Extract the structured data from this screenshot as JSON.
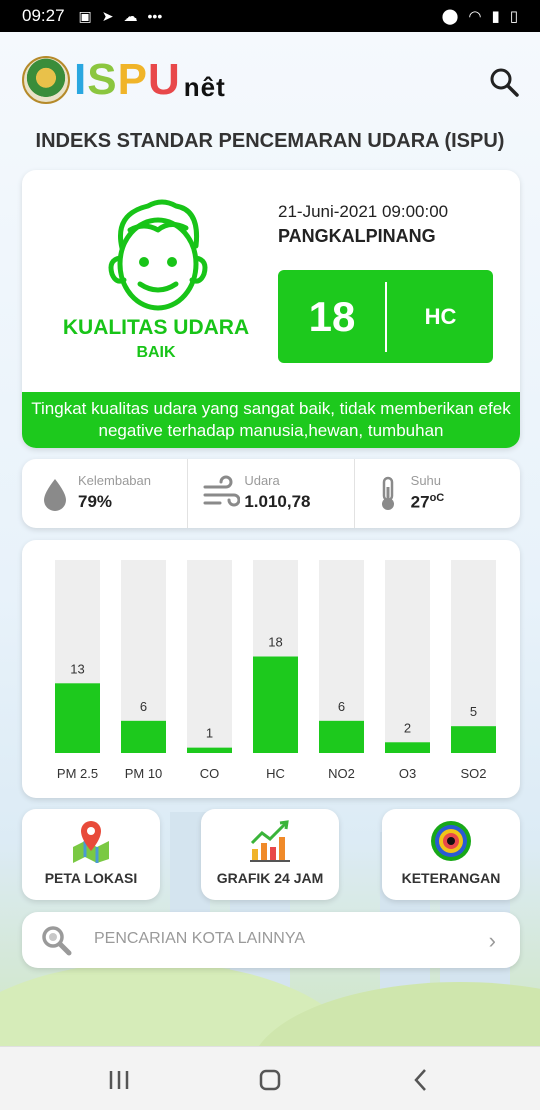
{
  "status_bar": {
    "time": "09:27",
    "icons": [
      "notification-icon",
      "telegram-icon",
      "weather-icon",
      "more-icon"
    ],
    "right_icons": [
      "location-icon",
      "wifi-icon",
      "signal-icon",
      "battery-icon"
    ]
  },
  "header": {
    "logo_letters": [
      "I",
      "S",
      "P",
      "U"
    ],
    "logo_suffix": "nêt"
  },
  "page_title": "INDEKS STANDAR PENCEMARAN UDARA (ISPU)",
  "summary": {
    "quality_label": "KUALITAS UDARA",
    "quality_status": "BAIK",
    "datetime": "21-Juni-2021 09:00:00",
    "city": "PANGKALPINANG",
    "value": "18",
    "parameter": "HC",
    "description": "Tingkat kualitas udara yang sangat baik, tidak memberikan efek negative terhadap manusia,hewan, tumbuhan",
    "status_color": "#1dc91d"
  },
  "weather": [
    {
      "label": "Kelembaban",
      "value": "79%",
      "icon": "droplet-icon"
    },
    {
      "label": "Udara",
      "value": "1.010,78",
      "icon": "wind-icon"
    },
    {
      "label": "Suhu",
      "value": "27",
      "unit": "oC",
      "icon": "thermometer-icon"
    }
  ],
  "chart_data": {
    "type": "bar",
    "categories": [
      "PM 2.5",
      "PM 10",
      "CO",
      "HC",
      "NO2",
      "O3",
      "SO2"
    ],
    "values": [
      13,
      6,
      1,
      18,
      6,
      2,
      5
    ],
    "ylim": [
      0,
      36
    ],
    "bar_color": "#1dc91d",
    "track_color": "#eeeeee"
  },
  "menu": [
    {
      "label": "PETA LOKASI",
      "icon": "map-pin-icon"
    },
    {
      "label": "GRAFIK 24 JAM",
      "icon": "bar-chart-icon"
    },
    {
      "label": "KETERANGAN",
      "icon": "target-icon"
    }
  ],
  "search": {
    "placeholder": "PENCARIAN KOTA LAINNYA"
  }
}
